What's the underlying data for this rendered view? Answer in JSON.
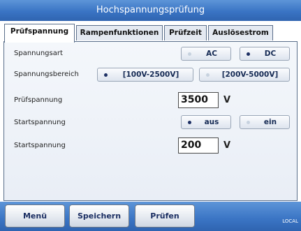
{
  "window": {
    "title": "Hochspannungsprüfung"
  },
  "tabs": [
    {
      "label": "Prüfspannung",
      "active": true
    },
    {
      "label": "Rampenfunktionen",
      "active": false
    },
    {
      "label": "Prüfzeit",
      "active": false
    },
    {
      "label": "Auslösestrom",
      "active": false
    }
  ],
  "form": {
    "spannungsart": {
      "label": "Spannungsart",
      "options": [
        {
          "label": "AC",
          "selected": false
        },
        {
          "label": "DC",
          "selected": true
        }
      ]
    },
    "spannungsbereich": {
      "label": "Spannungsbereich",
      "options": [
        {
          "label": "[100V-2500V]",
          "selected": true
        },
        {
          "label": "[200V-5000V]",
          "selected": false
        }
      ]
    },
    "pruefspannung": {
      "label": "Prüfspannung",
      "value": "3500",
      "unit": "V"
    },
    "startspannung_mode": {
      "label": "Startspannung",
      "options": [
        {
          "label": "aus",
          "selected": true
        },
        {
          "label": "ein",
          "selected": false
        }
      ]
    },
    "startspannung_value": {
      "label": "Startspannung",
      "value": "200",
      "unit": "V"
    }
  },
  "footer": {
    "buttons": [
      {
        "label": "Menü"
      },
      {
        "label": "Speichern"
      },
      {
        "label": "Prüfen"
      }
    ],
    "status": "LOCAL"
  },
  "colors": {
    "title_bar": "#3a74c4",
    "selected_dot": "#1c2f63",
    "button_text": "#1c2f63"
  }
}
